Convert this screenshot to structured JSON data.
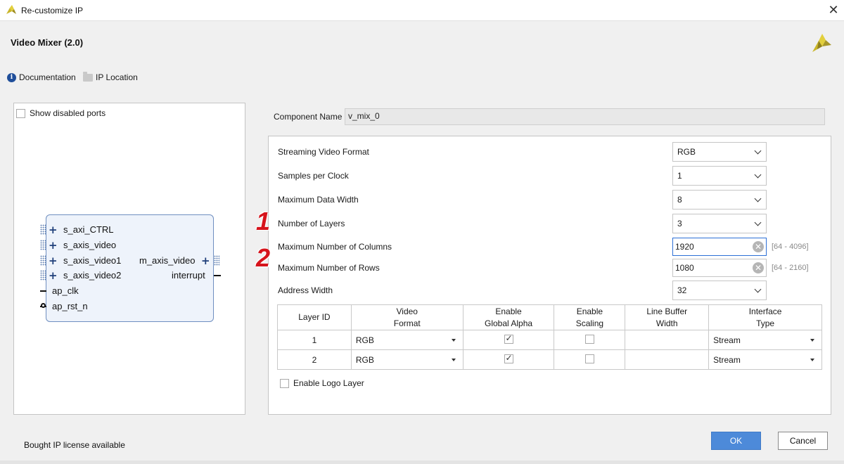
{
  "window": {
    "title": "Re-customize IP",
    "close_glyph": "✕"
  },
  "header": {
    "ip_title": "Video Mixer (2.0)",
    "documentation_label": "Documentation",
    "ip_location_label": "IP Location",
    "info_icon_glyph": "i"
  },
  "left_panel": {
    "show_disabled_ports_label": "Show disabled ports",
    "show_disabled_ports_checked": false,
    "block": {
      "left_ports": [
        "s_axi_CTRL",
        "s_axis_video",
        "s_axis_video1",
        "s_axis_video2",
        "ap_clk",
        "ap_rst_n"
      ],
      "right_ports": [
        "m_axis_video",
        "interrupt"
      ]
    }
  },
  "component": {
    "label": "Component Name",
    "value": "v_mix_0"
  },
  "params": {
    "streaming_format": {
      "label": "Streaming Video Format",
      "value": "RGB"
    },
    "samples_per_clock": {
      "label": "Samples per Clock",
      "value": "1"
    },
    "max_data_width": {
      "label": "Maximum Data Width",
      "value": "8"
    },
    "num_layers": {
      "label": "Number of Layers",
      "value": "3"
    },
    "max_columns": {
      "label": "Maximum Number of Columns",
      "value": "1920",
      "range": "[64 - 4096]"
    },
    "max_rows": {
      "label": "Maximum Number of Rows",
      "value": "1080",
      "range": "[64 - 2160]"
    },
    "address_width": {
      "label": "Address Width",
      "value": "32"
    }
  },
  "annotations": {
    "marker1": "1",
    "marker2": "2"
  },
  "layer_table": {
    "headers": {
      "layer_id": "Layer ID",
      "video_format_1": "Video",
      "video_format_2": "Format",
      "global_alpha_1": "Enable",
      "global_alpha_2": "Global Alpha",
      "scaling_1": "Enable",
      "scaling_2": "Scaling",
      "line_buffer_1": "Line Buffer",
      "line_buffer_2": "Width",
      "interface_1": "Interface",
      "interface_2": "Type"
    },
    "rows": [
      {
        "id": "1",
        "format": "RGB",
        "global_alpha": true,
        "scaling": false,
        "line_buffer": "",
        "interface": "Stream"
      },
      {
        "id": "2",
        "format": "RGB",
        "global_alpha": true,
        "scaling": false,
        "line_buffer": "",
        "interface": "Stream"
      }
    ]
  },
  "logo_layer": {
    "label": "Enable Logo Layer",
    "checked": false
  },
  "footer": {
    "license_text": "Bought IP license available",
    "ok_label": "OK",
    "cancel_label": "Cancel"
  },
  "colors": {
    "ok_button": "#4d8ad9",
    "focus_border": "#2c6fd6",
    "marker": "#d6141c",
    "brand": "#c9b62a"
  }
}
